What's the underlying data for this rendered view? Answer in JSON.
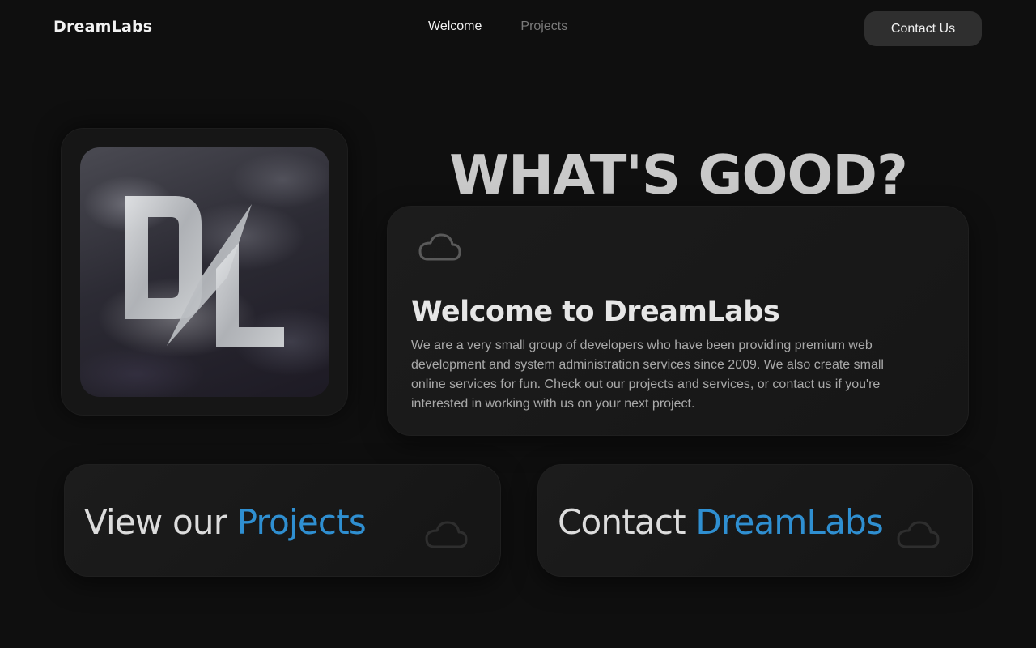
{
  "header": {
    "brand": "DreamLabs",
    "nav": [
      {
        "label": "Welcome",
        "active": true
      },
      {
        "label": "Projects",
        "active": false
      }
    ],
    "contact_button": "Contact Us"
  },
  "hero": {
    "logo_letters": "DL",
    "headline": "WHAT'S GOOD?"
  },
  "welcome_card": {
    "icon": "cloud-icon",
    "title": "Welcome to DreamLabs",
    "body": "We are a very small group of developers who have been providing premium web development and system administration services since 2009. We also create small online services for fun. Check out our projects and services, or contact us if you're interested in working with us on your next project."
  },
  "cta_cards": {
    "projects": {
      "prefix": "View our ",
      "accent": "Projects",
      "icon": "cloud-icon"
    },
    "contact": {
      "prefix": "Contact ",
      "accent": "DreamLabs",
      "icon": "cloud-icon"
    }
  },
  "colors": {
    "background": "#0f0f0f",
    "accent": "#2f8fd1",
    "card": "#1a1a1a",
    "button": "#2f2f2f"
  }
}
